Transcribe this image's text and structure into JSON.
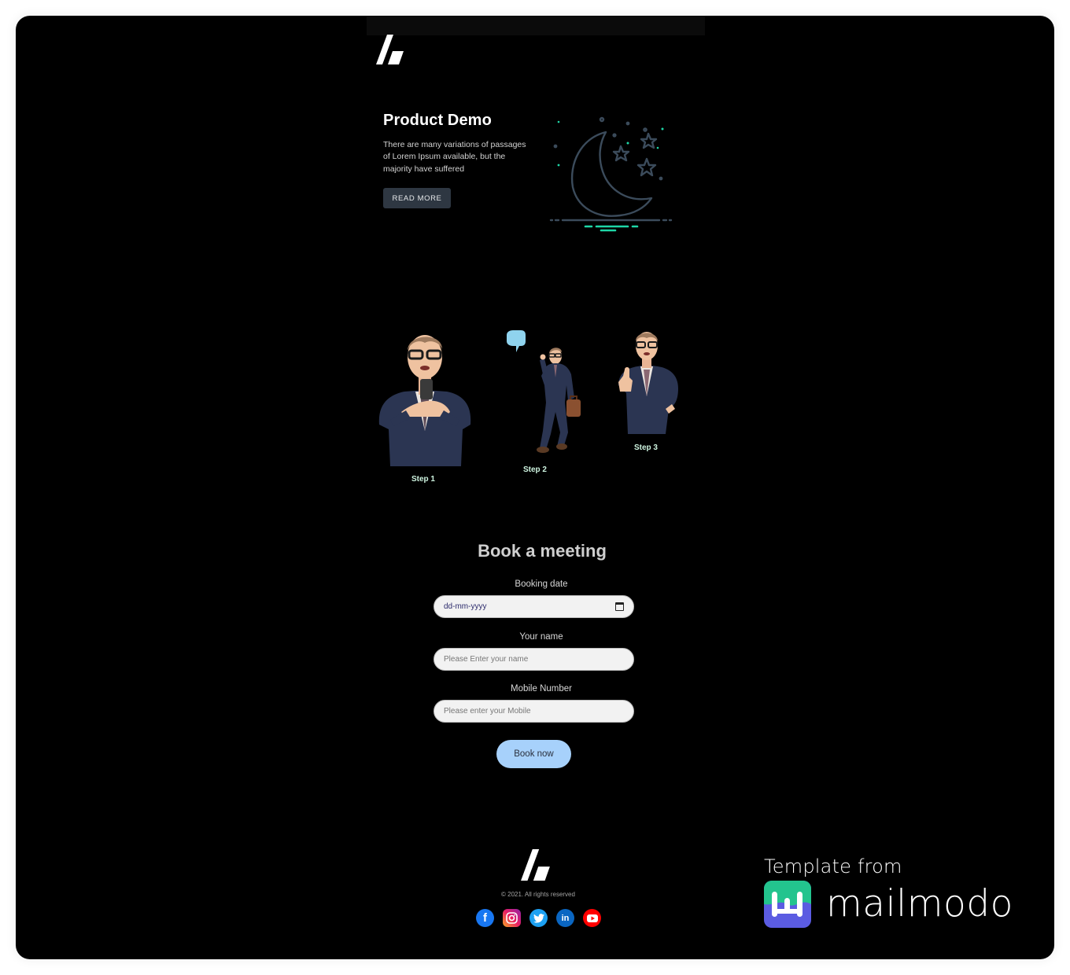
{
  "header": {
    "logo": "brand-logo"
  },
  "hero": {
    "title": "Product Demo",
    "text": "There are many variations of passages of Lorem Ipsum available, but the majority have suffered",
    "button_label": "READ MORE",
    "illustration": "moon-and-stars"
  },
  "steps": [
    {
      "label": "Step 1",
      "illustration": "businessman-with-phone"
    },
    {
      "label": "Step 2",
      "illustration": "businessman-walking-with-briefcase"
    },
    {
      "label": "Step 3",
      "illustration": "businessman-thumbs-up"
    }
  ],
  "booking": {
    "title": "Book a meeting",
    "fields": [
      {
        "label": "Booking date",
        "placeholder": "dd-mm-yyyy",
        "type": "date"
      },
      {
        "label": "Your name",
        "placeholder": "Please Enter your name",
        "type": "text"
      },
      {
        "label": "Mobile Number",
        "placeholder": "Please enter your Mobile",
        "type": "tel"
      }
    ],
    "submit_label": "Book now"
  },
  "footer": {
    "copyright": "© 2021. All rights reserved",
    "socials": [
      {
        "name": "facebook",
        "glyph": "f"
      },
      {
        "name": "instagram",
        "glyph": ""
      },
      {
        "name": "twitter",
        "glyph": ""
      },
      {
        "name": "linkedin",
        "glyph": "in"
      },
      {
        "name": "youtube",
        "glyph": ""
      }
    ]
  },
  "badge": {
    "prefix": "Template from",
    "brand": "mailmodo"
  },
  "colors": {
    "background": "#000000",
    "button_dark": "#2e3742",
    "step_label": "#cdf3df",
    "book_button": "#a7d1fb",
    "accent_teal": "#1ed6a6"
  }
}
